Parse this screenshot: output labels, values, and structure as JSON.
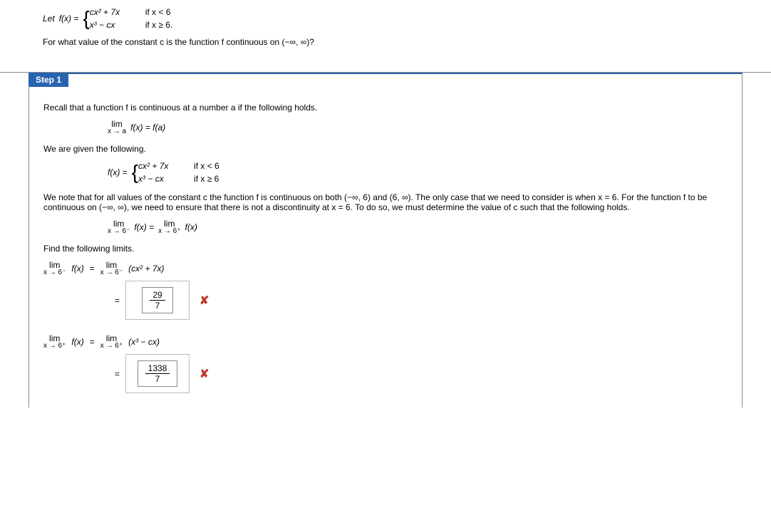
{
  "question": {
    "lead": "Let",
    "fx_eq": "f(x) =",
    "pieces": [
      {
        "expr": "cx² + 7x",
        "cond": "if  x < 6"
      },
      {
        "expr": "x³ − cx",
        "cond": "if  x ≥ 6."
      }
    ],
    "prompt": "For what value of the constant c is the function f continuous on (−∞, ∞)?"
  },
  "step": {
    "title": "Step 1",
    "recall": "Recall that a function f is continuous at a number a if the following holds.",
    "lim_def_top": "lim",
    "lim_def_sub": "x → a",
    "lim_def_rhs": "f(x) = f(a)",
    "given": "We are given the following.",
    "pieces": [
      {
        "expr": "cx² + 7x",
        "cond": "if  x < 6"
      },
      {
        "expr": "x³ − cx",
        "cond": "if  x ≥ 6"
      }
    ],
    "note": "We note that for all values of the constant c the function f is continuous on both (−∞, 6) and (6, ∞). The only case that we need to consider is when x = 6. For the function f to be continuous on (−∞, ∞), we need to ensure that there is not a discontinuity at x = 6. To do so, we must determine the value of c such that the following holds.",
    "lim_eq_left_top": "lim",
    "lim_eq_left_sub": "x → 6⁻",
    "lim_eq_mid": "f(x)  =",
    "lim_eq_right_top": "lim",
    "lim_eq_right_sub": "x → 6⁺",
    "lim_eq_rhs": "f(x)",
    "find": "Find the following limits.",
    "limits": [
      {
        "lhs_top": "lim",
        "lhs_sub": "x → 6⁻",
        "lhs_after": "f(x)",
        "rhs_top": "lim",
        "rhs_sub": "x → 6⁻",
        "rhs_expr": "(cx² + 7x)",
        "ans_num": "29",
        "ans_den": "7"
      },
      {
        "lhs_top": "lim",
        "lhs_sub": "x → 6⁺",
        "lhs_after": "f(x)",
        "rhs_top": "lim",
        "rhs_sub": "x → 6⁺",
        "rhs_expr": "(x³ − cx)",
        "ans_num": "1338",
        "ans_den": "7"
      }
    ]
  }
}
